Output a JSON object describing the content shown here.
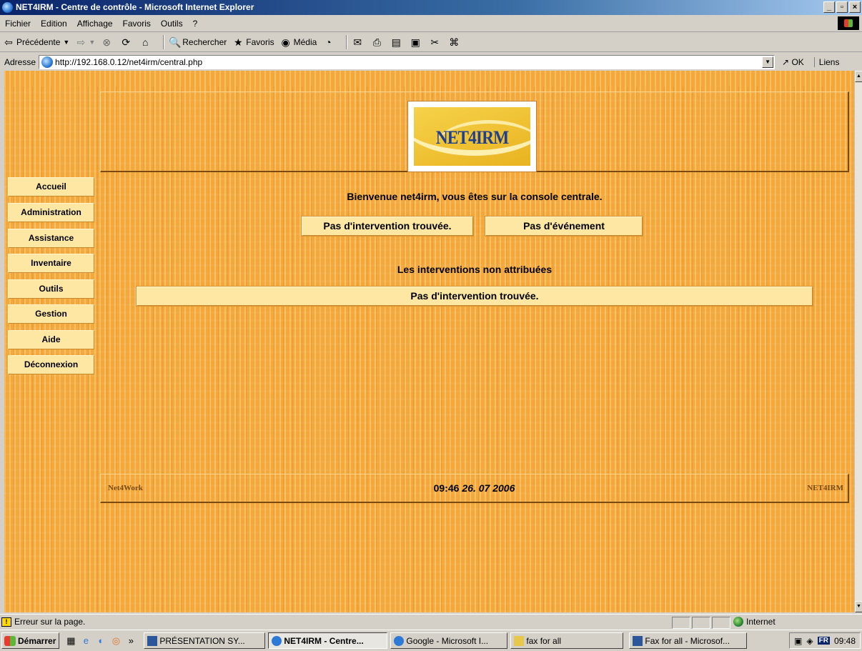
{
  "window": {
    "title": "NET4IRM - Centre de contrôle - Microsoft Internet Explorer",
    "min": "_",
    "max": "▫",
    "close": "×"
  },
  "menubar": {
    "items": [
      "Fichier",
      "Edition",
      "Affichage",
      "Favoris",
      "Outils",
      "?"
    ]
  },
  "toolbar": {
    "back": "Précédente",
    "search": "Rechercher",
    "favorites": "Favoris",
    "media": "Média"
  },
  "address": {
    "label": "Adresse",
    "url": "http://192.168.0.12/net4irm/central.php",
    "go": "OK",
    "links": "Liens"
  },
  "logo": {
    "text": "NET4IRM"
  },
  "nav": {
    "items": [
      "Accueil",
      "Administration",
      "Assistance",
      "Inventaire",
      "Outils",
      "Gestion",
      "Aide",
      "Déconnexion"
    ]
  },
  "main": {
    "welcome": "Bienvenue net4irm, vous êtes sur la console centrale.",
    "no_intervention": "Pas d'intervention trouvée.",
    "no_event": "Pas d'événement",
    "unassigned_title": "Les interventions non attribuées",
    "unassigned_empty": "Pas d'intervention trouvée."
  },
  "footer": {
    "left": "Net4Work",
    "time": "09:46",
    "date": "26. 07 2006",
    "right": "NET4IRM"
  },
  "status": {
    "message": "Erreur sur la page.",
    "zone": "Internet"
  },
  "taskbar": {
    "start": "Démarrer",
    "chevron": "»",
    "tasks": [
      "PRÉSENTATION SY...",
      "NET4IRM - Centre...",
      "Google - Microsoft I...",
      "fax for all",
      "Fax for all - Microsof..."
    ],
    "lang": "FR",
    "clock": "09:48"
  }
}
